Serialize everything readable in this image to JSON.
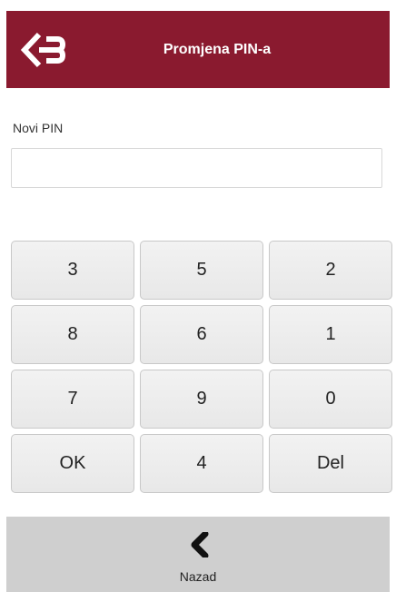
{
  "header": {
    "title": "Promjena PIN-a",
    "background_color": "#8a1a2f",
    "logo_icon": "bank-logo-icon"
  },
  "form": {
    "pin_label": "Novi PIN",
    "pin_value": "",
    "pin_placeholder": ""
  },
  "keypad": {
    "keys": [
      "3",
      "5",
      "2",
      "8",
      "6",
      "1",
      "7",
      "9",
      "0",
      "OK",
      "4",
      "Del"
    ]
  },
  "footer": {
    "back_label": "Nazad",
    "back_icon": "chevron-left-icon",
    "background_color": "#cfcfcf"
  }
}
